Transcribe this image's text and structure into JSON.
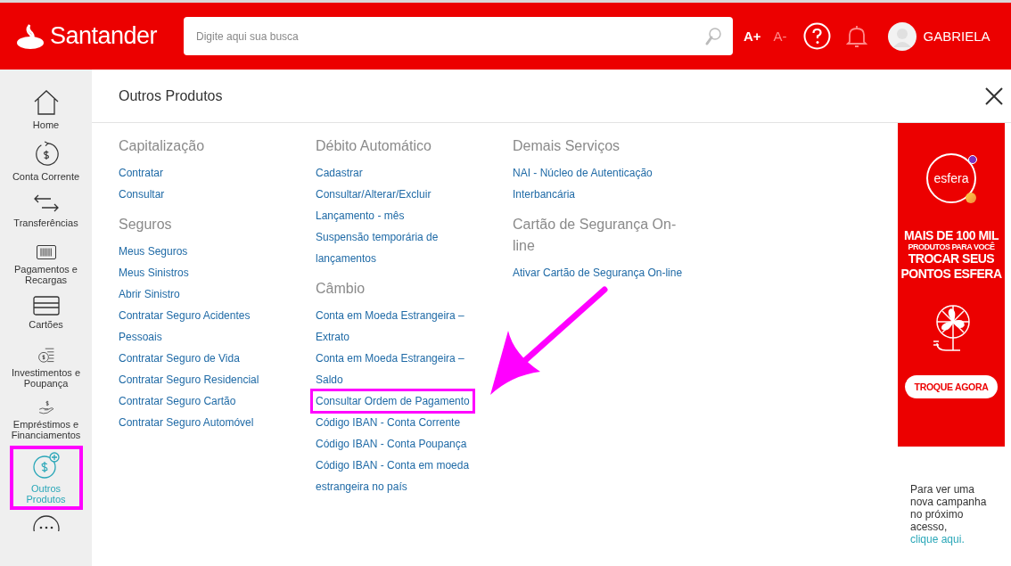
{
  "header": {
    "brand": "Santander",
    "search": {
      "placeholder": "Digite aqui sua busca"
    },
    "font_controls": [
      {
        "label": "A+",
        "disabled": false
      },
      {
        "label": "A-",
        "disabled": true
      }
    ],
    "notifications": {
      "disabled": true
    },
    "user": {
      "name": "GABRIELA"
    }
  },
  "sidebar": {
    "items": [
      {
        "label": "Home",
        "selected": false,
        "highlighted": false
      },
      {
        "label": "Conta Corrente",
        "selected": false,
        "highlighted": false
      },
      {
        "label": "Transferências",
        "selected": false,
        "highlighted": false
      },
      {
        "label": "Pagamentos e Recargas",
        "selected": false,
        "highlighted": false
      },
      {
        "label": "Cartões",
        "selected": false,
        "highlighted": false
      },
      {
        "label": "Investimentos e Poupança",
        "selected": false,
        "highlighted": false
      },
      {
        "label": "Empréstimos e Financiamentos",
        "selected": false,
        "highlighted": false
      },
      {
        "label": "Outros Produtos",
        "selected": true,
        "highlighted": true
      }
    ]
  },
  "panel": {
    "title": "Outros Produtos",
    "columns": [
      {
        "sections": [
          {
            "heading": [
              "Capitalização"
            ],
            "links": [
              {
                "lines": [
                  "Contratar"
                ],
                "highlighted": false
              },
              {
                "lines": [
                  "Consultar"
                ],
                "highlighted": false
              }
            ]
          },
          {
            "heading": [
              "Seguros"
            ],
            "links": [
              {
                "lines": [
                  "Meus Seguros"
                ],
                "highlighted": false
              },
              {
                "lines": [
                  "Meus Sinistros"
                ],
                "highlighted": false
              },
              {
                "lines": [
                  "Abrir Sinistro"
                ],
                "highlighted": false
              },
              {
                "lines": [
                  "Contratar Seguro Acidentes",
                  "Pessoais"
                ],
                "highlighted": false
              },
              {
                "lines": [
                  "Contratar Seguro de Vida"
                ],
                "highlighted": false
              },
              {
                "lines": [
                  "Contratar Seguro Residencial"
                ],
                "highlighted": false
              },
              {
                "lines": [
                  "Contratar Seguro Cartão"
                ],
                "highlighted": false
              },
              {
                "lines": [
                  "Contratar Seguro Automóvel"
                ],
                "highlighted": false
              }
            ]
          }
        ]
      },
      {
        "sections": [
          {
            "heading": [
              "Débito Automático"
            ],
            "links": [
              {
                "lines": [
                  "Cadastrar"
                ],
                "highlighted": false
              },
              {
                "lines": [
                  "Consultar/Alterar/Excluir"
                ],
                "highlighted": false
              },
              {
                "lines": [
                  "Lançamento - mês"
                ],
                "highlighted": false
              },
              {
                "lines": [
                  "Suspensão temporária de",
                  "lançamentos"
                ],
                "highlighted": false
              }
            ]
          },
          {
            "heading": [
              "Câmbio"
            ],
            "links": [
              {
                "lines": [
                  "Conta em Moeda Estrangeira –",
                  "Extrato"
                ],
                "highlighted": false
              },
              {
                "lines": [
                  "Conta em Moeda Estrangeira –",
                  "Saldo"
                ],
                "highlighted": false
              },
              {
                "lines": [
                  "Consultar Ordem de Pagamento"
                ],
                "highlighted": true
              },
              {
                "lines": [
                  "Código IBAN - Conta Corrente"
                ],
                "highlighted": false
              },
              {
                "lines": [
                  "Código IBAN - Conta Poupança"
                ],
                "highlighted": false
              },
              {
                "lines": [
                  "Código IBAN - Conta em moeda",
                  "estrangeira no país"
                ],
                "highlighted": false
              }
            ]
          }
        ]
      },
      {
        "sections": [
          {
            "heading": [
              "Demais Serviços"
            ],
            "links": [
              {
                "lines": [
                  "NAI - Núcleo de Autenticação"
                ],
                "highlighted": false
              },
              {
                "lines": [
                  "Interbancária"
                ],
                "highlighted": false
              }
            ]
          },
          {
            "heading": [
              "Cartão de Segurança On-",
              "line"
            ],
            "links": [
              {
                "lines": [
                  "Ativar Cartão de Segurança On-line"
                ],
                "highlighted": false
              }
            ]
          }
        ]
      }
    ]
  },
  "ad": {
    "logo": "esfera",
    "headline": [
      "MAIS DE 100 MIL",
      "PRODUTOS PARA VOCÊ",
      "TROCAR SEUS",
      "PONTOS ESFERA"
    ],
    "button": "TROQUE AGORA",
    "note": "Para ver uma nova campanha no próximo acesso,",
    "note_link": "clique aqui."
  }
}
